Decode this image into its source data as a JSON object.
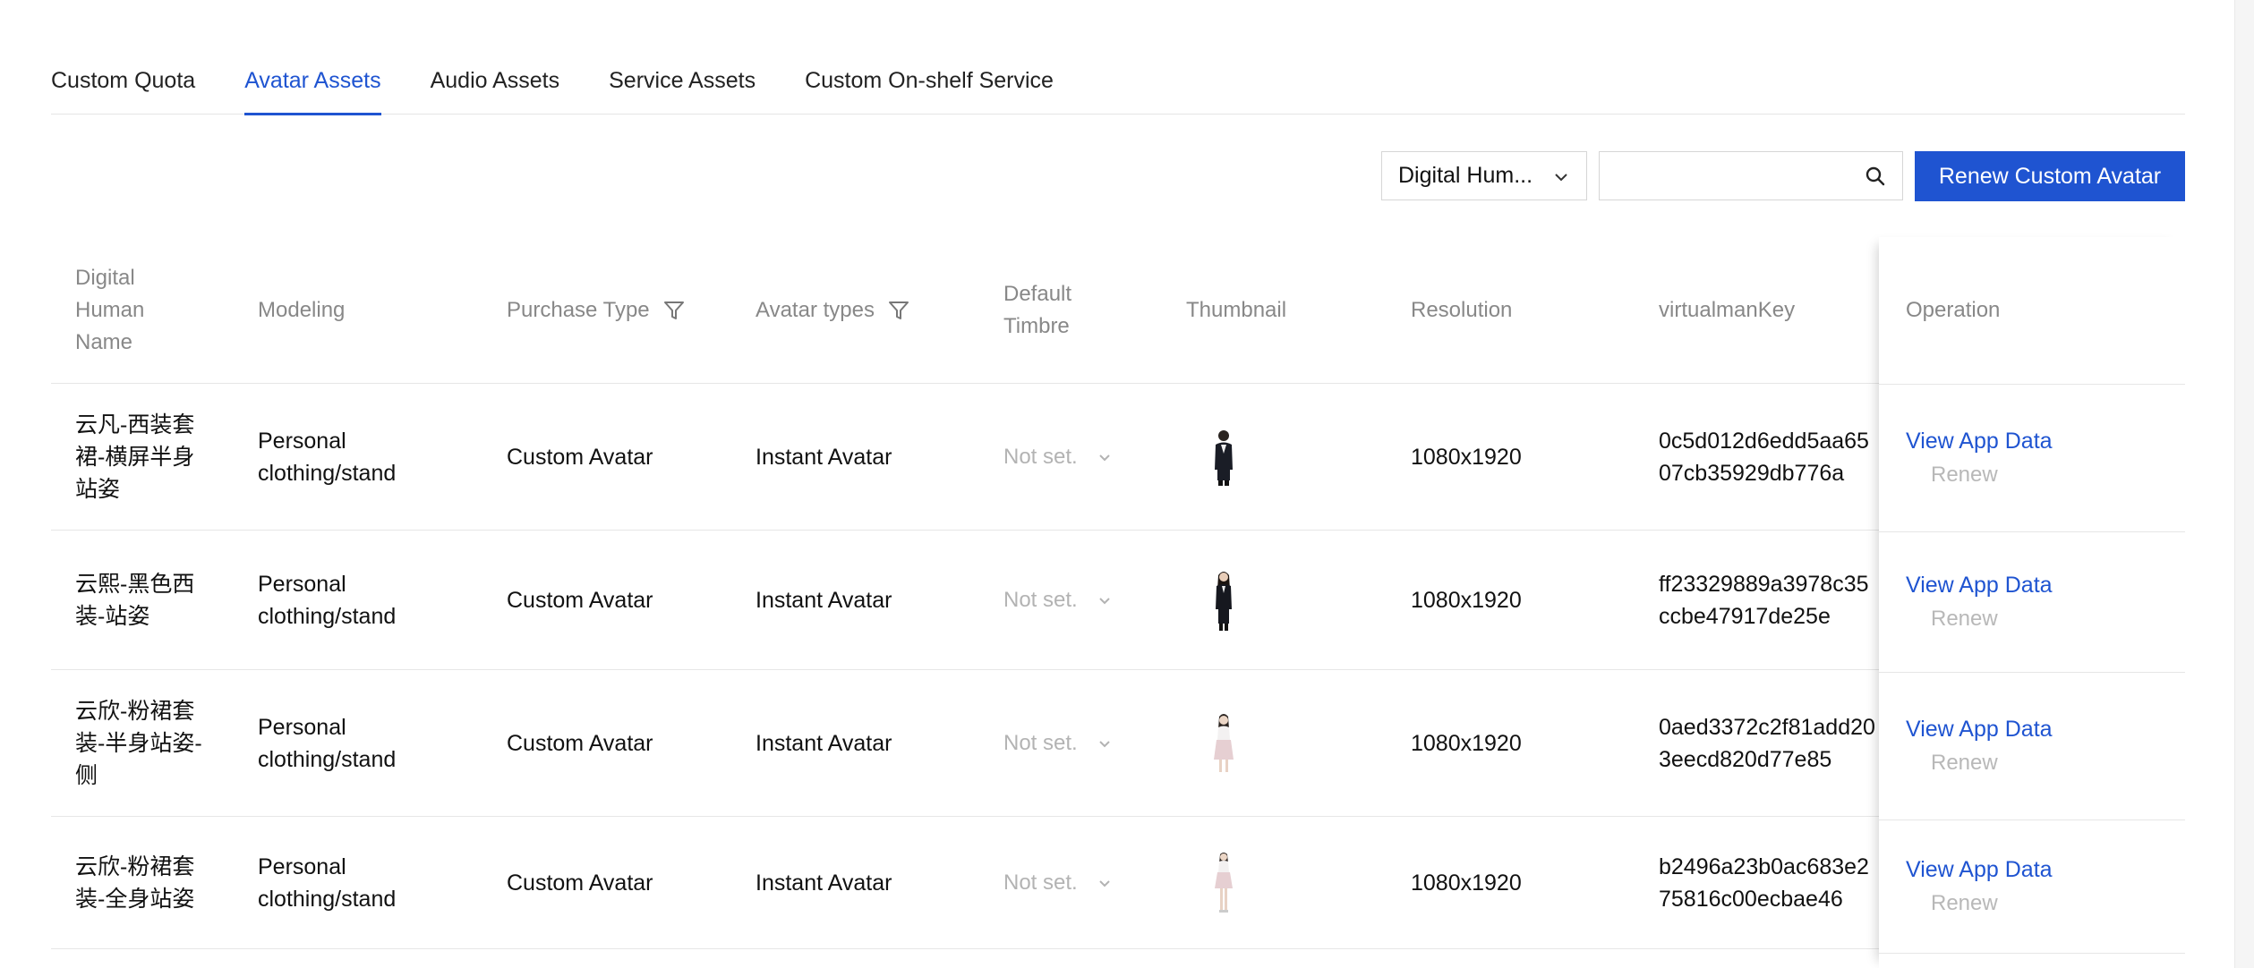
{
  "tabs": [
    {
      "label": "Custom Quota",
      "active": false
    },
    {
      "label": "Avatar Assets",
      "active": true
    },
    {
      "label": "Audio Assets",
      "active": false
    },
    {
      "label": "Service Assets",
      "active": false
    },
    {
      "label": "Custom On-shelf Service",
      "active": false
    }
  ],
  "toolbar": {
    "filter_select_value": "Digital Hum...",
    "search_value": "",
    "renew_button_label": "Renew Custom Avatar"
  },
  "table": {
    "columns": {
      "name": [
        "Digital",
        "Human",
        "Name"
      ],
      "modeling": "Modeling",
      "purchase_type": "Purchase Type",
      "avatar_types": "Avatar types",
      "default_timbre": [
        "Default",
        "Timbre"
      ],
      "thumbnail": "Thumbnail",
      "resolution": "Resolution",
      "virtualman_key": "virtualmanKey",
      "operation": "Operation"
    },
    "rows": [
      {
        "name_lines": [
          "云凡-西装套",
          "裙-横屏半身",
          "站姿"
        ],
        "modeling_lines": [
          "Personal",
          "clothing/stand"
        ],
        "purchase_type": "Custom Avatar",
        "avatar_type": "Instant Avatar",
        "default_timbre": "Not set.",
        "resolution": "1080x1920",
        "key_lines": [
          "0c5d012d6edd5aa65",
          "07cb35929db776a"
        ],
        "view_label": "View App Data",
        "renew_label": "Renew",
        "thumb_style": "dark-suit-half"
      },
      {
        "name_lines": [
          "云熙-黑色西",
          "装-站姿"
        ],
        "modeling_lines": [
          "Personal",
          "clothing/stand"
        ],
        "purchase_type": "Custom Avatar",
        "avatar_type": "Instant Avatar",
        "default_timbre": "Not set.",
        "resolution": "1080x1920",
        "key_lines": [
          "ff23329889a3978c35",
          "ccbe47917de25e"
        ],
        "view_label": "View App Data",
        "renew_label": "Renew",
        "thumb_style": "dark-suit-full"
      },
      {
        "name_lines": [
          "云欣-粉裙套",
          "装-半身站姿-",
          "侧"
        ],
        "modeling_lines": [
          "Personal",
          "clothing/stand"
        ],
        "purchase_type": "Custom Avatar",
        "avatar_type": "Instant Avatar",
        "default_timbre": "Not set.",
        "resolution": "1080x1920",
        "key_lines": [
          "0aed3372c2f81add20",
          "3eecd820d77e85"
        ],
        "view_label": "View App Data",
        "renew_label": "Renew",
        "thumb_style": "pink-dress-half"
      },
      {
        "name_lines": [
          "云欣-粉裙套",
          "装-全身站姿"
        ],
        "modeling_lines": [
          "Personal",
          "clothing/stand"
        ],
        "purchase_type": "Custom Avatar",
        "avatar_type": "Instant Avatar",
        "default_timbre": "Not set.",
        "resolution": "1080x1920",
        "key_lines": [
          "b2496a23b0ac683e2",
          "75816c00ecbae46"
        ],
        "view_label": "View App Data",
        "renew_label": "Renew",
        "thumb_style": "pink-dress-full"
      }
    ]
  },
  "colors": {
    "accent": "#1f54d1",
    "header_text": "#888888",
    "muted_text": "#b3b3b3",
    "border": "#e6e6e6"
  }
}
